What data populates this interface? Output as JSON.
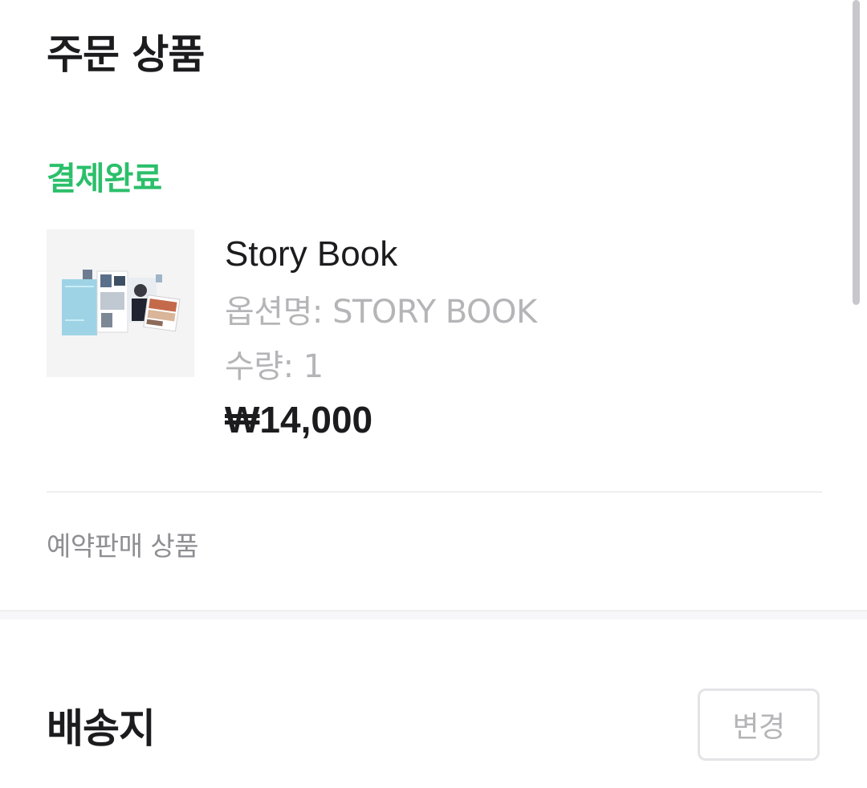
{
  "order_section": {
    "title": "주문 상품",
    "status": "결제완료",
    "colors": {
      "status": "#2bbf6a",
      "muted": "#b5b5b8"
    }
  },
  "product": {
    "name": "Story Book",
    "option": "옵션명: STORY BOOK",
    "quantity": "수량: 1",
    "price": "₩14,000",
    "image": "story-book-thumbnail"
  },
  "preorder_label": "예약판매 상품",
  "shipping_section": {
    "title": "배송지",
    "change_label": "변경"
  }
}
